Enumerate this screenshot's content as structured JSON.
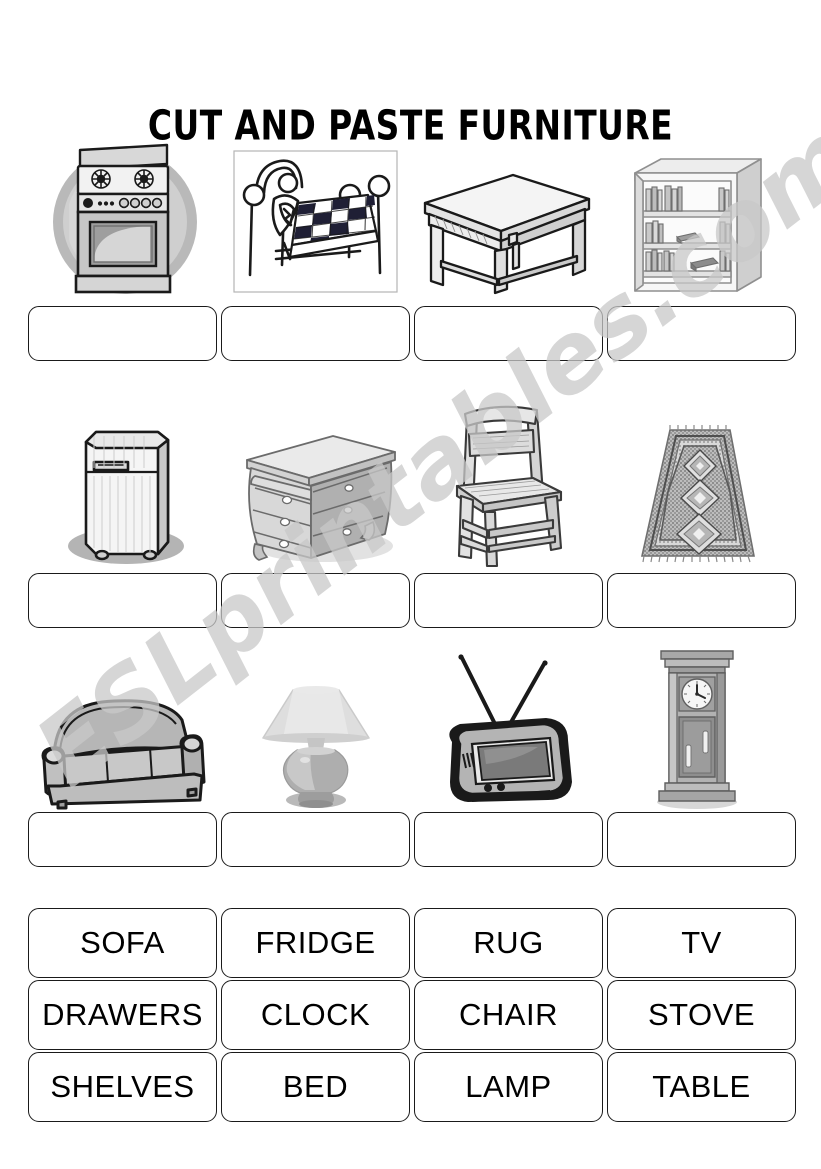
{
  "page": {
    "title": "CUT AND PASTE FURNITURE",
    "background_color": "#ffffff",
    "ink_color": "#000000"
  },
  "watermark": {
    "text": "ESLprintables.com",
    "color": "#c9c9c9"
  },
  "picture_rows": [
    {
      "row": 1,
      "items": [
        {
          "icon": "stove-icon",
          "answer": "STOVE"
        },
        {
          "icon": "bed-icon",
          "answer": "BED"
        },
        {
          "icon": "table-icon",
          "answer": "TABLE"
        },
        {
          "icon": "shelves-icon",
          "answer": "SHELVES"
        }
      ]
    },
    {
      "row": 2,
      "items": [
        {
          "icon": "fridge-icon",
          "answer": "FRIDGE"
        },
        {
          "icon": "drawers-icon",
          "answer": "DRAWERS"
        },
        {
          "icon": "chair-icon",
          "answer": "CHAIR"
        },
        {
          "icon": "rug-icon",
          "answer": "RUG"
        }
      ]
    },
    {
      "row": 3,
      "items": [
        {
          "icon": "sofa-icon",
          "answer": "SOFA"
        },
        {
          "icon": "lamp-icon",
          "answer": "LAMP"
        },
        {
          "icon": "tv-icon",
          "answer": "TV"
        },
        {
          "icon": "clock-icon",
          "answer": "CLOCK"
        }
      ]
    }
  ],
  "answer_boxes": {
    "row1": [
      "",
      "",
      "",
      ""
    ],
    "row2": [
      "",
      "",
      "",
      ""
    ],
    "row3": [
      "",
      "",
      "",
      ""
    ]
  },
  "word_bank": {
    "rows": [
      [
        "SOFA",
        "FRIDGE",
        "RUG",
        "TV"
      ],
      [
        "DRAWERS",
        "CLOCK",
        "CHAIR",
        "STOVE"
      ],
      [
        "SHELVES",
        "BED",
        "LAMP",
        "TABLE"
      ]
    ]
  }
}
